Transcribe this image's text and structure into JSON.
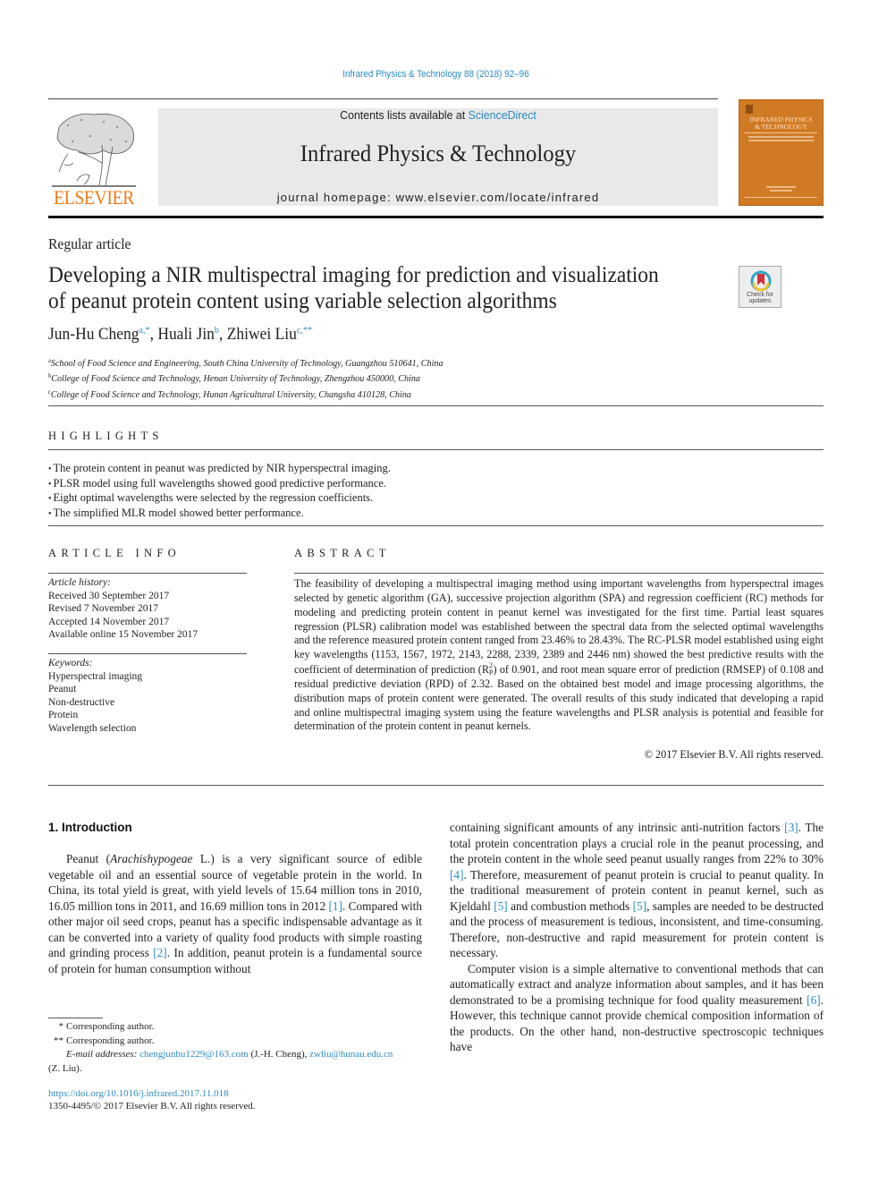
{
  "header": {
    "journal_reference": "Infrared Physics & Technology 88 (2018) 92–96",
    "publisher_logo_text": "ELSEVIER",
    "contents_prefix": "Contents lists available at ",
    "contents_link": "ScienceDirect",
    "journal_title": "Infrared Physics & Technology",
    "homepage_prefix": "journal homepage: ",
    "homepage_url": "www.elsevier.com/locate/infrared",
    "cover_title_line1": "INFRARED PHYSICS",
    "cover_title_line2": "& TECHNOLOGY",
    "check_updates_line1": "Check for",
    "check_updates_line2": "updates"
  },
  "article": {
    "type": "Regular article",
    "title_line1": "Developing a NIR multispectral imaging for prediction and visualization",
    "title_line2": "of peanut protein content using variable selection algorithms",
    "authors": [
      {
        "name": "Jun-Hu Cheng",
        "sup": "a,*"
      },
      {
        "name": "Huali Jin",
        "sup": "b"
      },
      {
        "name": "Zhiwei Liu",
        "sup": "c,**"
      }
    ],
    "affiliations": [
      {
        "key": "a",
        "text": "School of Food Science and Engineering, South China University of Technology, Guangzhou 510641, China"
      },
      {
        "key": "b",
        "text": "College of Food Science and Technology, Henan University of Technology, Zhengzhou 450000, China"
      },
      {
        "key": "c",
        "text": "College of Food Science and Technology, Hunan Agricultural University, Changsha 410128, China"
      }
    ]
  },
  "highlights": {
    "heading": "HIGHLIGHTS",
    "items": [
      "The protein content in peanut was predicted by NIR hyperspectral imaging.",
      "PLSR model using full wavelengths showed good predictive performance.",
      "Eight optimal wavelengths were selected by the regression coefficients.",
      "The simplified MLR model showed better performance."
    ]
  },
  "article_info": {
    "heading": "ARTICLE INFO",
    "history_label": "Article history:",
    "history": [
      "Received 30 September 2017",
      "Revised 7 November 2017",
      "Accepted 14 November 2017",
      "Available online 15 November 2017"
    ],
    "keywords_label": "Keywords:",
    "keywords": [
      "Hyperspectral imaging",
      "Peanut",
      "Non-destructive",
      "Protein",
      "Wavelength selection"
    ]
  },
  "abstract": {
    "heading": "ABSTRACT",
    "part1": "The feasibility of developing a multispectral imaging method using important wavelengths from hyper­spectral images selected by genetic algorithm (GA), successive projection algorithm (SPA) and regression coefficient (RC) methods for modeling and predicting protein content in peanut kernel was investigated for the first time. Partial least squares regression (PLSR) calibration model was established between the spectral data from the selected optimal wavelengths and the reference measured protein content ranged from 23.46% to 28.43%. The RC-PLSR model established using eight key wavelengths (1153, 1567, 1972, 2143, 2288, 2339, 2389 and 2446 nm) showed the best predictive results with the coefficient of determi­nation of prediction (R",
    "r_sup": "2",
    "r_sub": "P",
    "part2": ") of 0.901, and root mean square error of prediction (RMSEP) of 0.108 and residual predictive deviation (RPD) of 2.32. Based on the obtained best model and image processing algorithms, the distribution maps of protein content were generated. The overall results of this study indicated that devel­oping a rapid and online multispectral imaging system using the feature wavelengths and PLSR analysis is potential and feasible for determination of the protein content in peanut kernels.",
    "copyright": "© 2017 Elsevier B.V. All rights reserved."
  },
  "introduction": {
    "heading": "1. Introduction",
    "left": {
      "s1": "Peanut (",
      "species": "Arachishypogeae",
      "s2": " L.) is a very significant source of edible vegetable oil and an essential source of vegetable protein in the world. In China, its total yield is great, with yield levels of 15.64 million tons in 2010, 16.05 million tons in 2011, and 16.69 mil­lion tons in 2012 ",
      "r1": "[1]",
      "s3": ". Compared with other major oil seed crops, peanut has a specific indispensable advantage as it can be con­verted into a variety of quality food products with simple roasting and grinding process ",
      "r2": "[2]",
      "s4": ". In addition, peanut protein is a fundamental source of protein for human consumption without"
    },
    "right": {
      "s1": "containing significant amounts of any intrinsic anti-nutrition fac­tors ",
      "r3": "[3]",
      "s2": ". The total protein concentration plays a crucial role in the peanut processing, and the protein content in the whole seed pea­nut usually ranges from 22% to 30% ",
      "r4": "[4]",
      "s3": ". Therefore, measurement of peanut protein is crucial to peanut quality. In the traditional mea­surement of protein content in peanut kernel, such as Kjeldahl ",
      "r5a": "[5]",
      "s4": " and combustion methods ",
      "r5b": "[5]",
      "s5": ", samples are needed to be destructed and the process of measurement is tedious, inconsistent, and time-consuming. Therefore, non-destructive and rapid measurement for protein content is necessary.",
      "p2_s1": "Computer vision is a simple alternative to conventional meth­ods that can automatically extract and analyze information about samples, and it has been demonstrated to be a promising tech­nique for food quality measurement ",
      "r6": "[6]",
      "p2_s2": ". However, this technique cannot provide chemical composition information of the products. On the other hand, non-destructive spectroscopic techniques have"
    }
  },
  "footnotes": {
    "fn1_mark": "*",
    "fn1_text": "Corresponding author.",
    "fn2_mark": "**",
    "fn2_text": "Corresponding author.",
    "email_label": "E-mail addresses:",
    "email1": "chengjunhu1229@163.com",
    "email1_owner": " (J.-H. Cheng), ",
    "email2": "zwliu@hunau.edu.cn",
    "email2_owner": "(Z. Liu).",
    "doi": "https://doi.org/10.1016/j.infrared.2017.11.018",
    "issn": "1350-4495/© 2017 Elsevier B.V. All rights reserved."
  }
}
